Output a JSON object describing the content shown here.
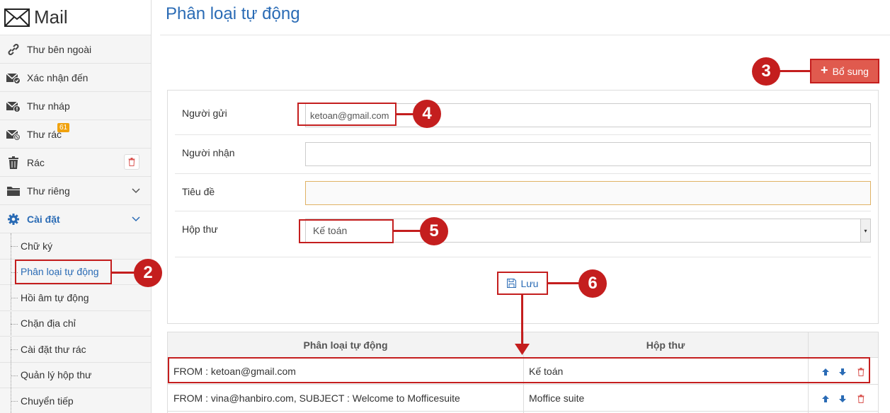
{
  "app": {
    "title": "Mail"
  },
  "sidebar": {
    "items": [
      {
        "label": "Thư bên ngoài",
        "icon": "link-icon"
      },
      {
        "label": "Xác nhận đến",
        "icon": "mail-check-icon"
      },
      {
        "label": "Thư nháp",
        "icon": "mail-draft-icon"
      },
      {
        "label": "Thư rác",
        "icon": "mail-spam-icon",
        "badge": "61"
      },
      {
        "label": "Rác",
        "icon": "trash-icon"
      },
      {
        "label": "Thư riêng",
        "icon": "folder-icon"
      },
      {
        "label": "Cài đặt",
        "icon": "gear-icon"
      }
    ],
    "settings_sub": [
      "Chữ ký",
      "Phân loại tự động",
      "Hồi âm tự động",
      "Chặn địa chỉ",
      "Cài đặt thư rác",
      "Quản lý hộp thư",
      "Chuyển tiếp"
    ]
  },
  "main": {
    "title": "Phân loại tự động",
    "add_label": "Bổ sung",
    "form": {
      "sender_label": "Người gửi",
      "sender_value": "ketoan@gmail.com",
      "recipient_label": "Người nhận",
      "recipient_value": "",
      "subject_label": "Tiêu đề",
      "subject_value": "",
      "mailbox_label": "Hộp thư",
      "mailbox_value": "Kế toán",
      "save_label": "Lưu"
    },
    "table": {
      "headers": [
        "Phân loại tự động",
        "Hộp thư"
      ],
      "rows": [
        {
          "rule": "FROM : ketoan@gmail.com",
          "mailbox": "Kế toán"
        },
        {
          "rule": "FROM : vina@hanbiro.com, SUBJECT : Welcome to Mofficesuite",
          "mailbox": "Moffice suite"
        }
      ]
    }
  },
  "callouts": [
    "2",
    "3",
    "4",
    "5",
    "6"
  ],
  "colors": {
    "accent": "#2a6bb5",
    "annotation": "#c41e1e",
    "add_button": "#e05a4e",
    "badge": "#f0a20e"
  }
}
